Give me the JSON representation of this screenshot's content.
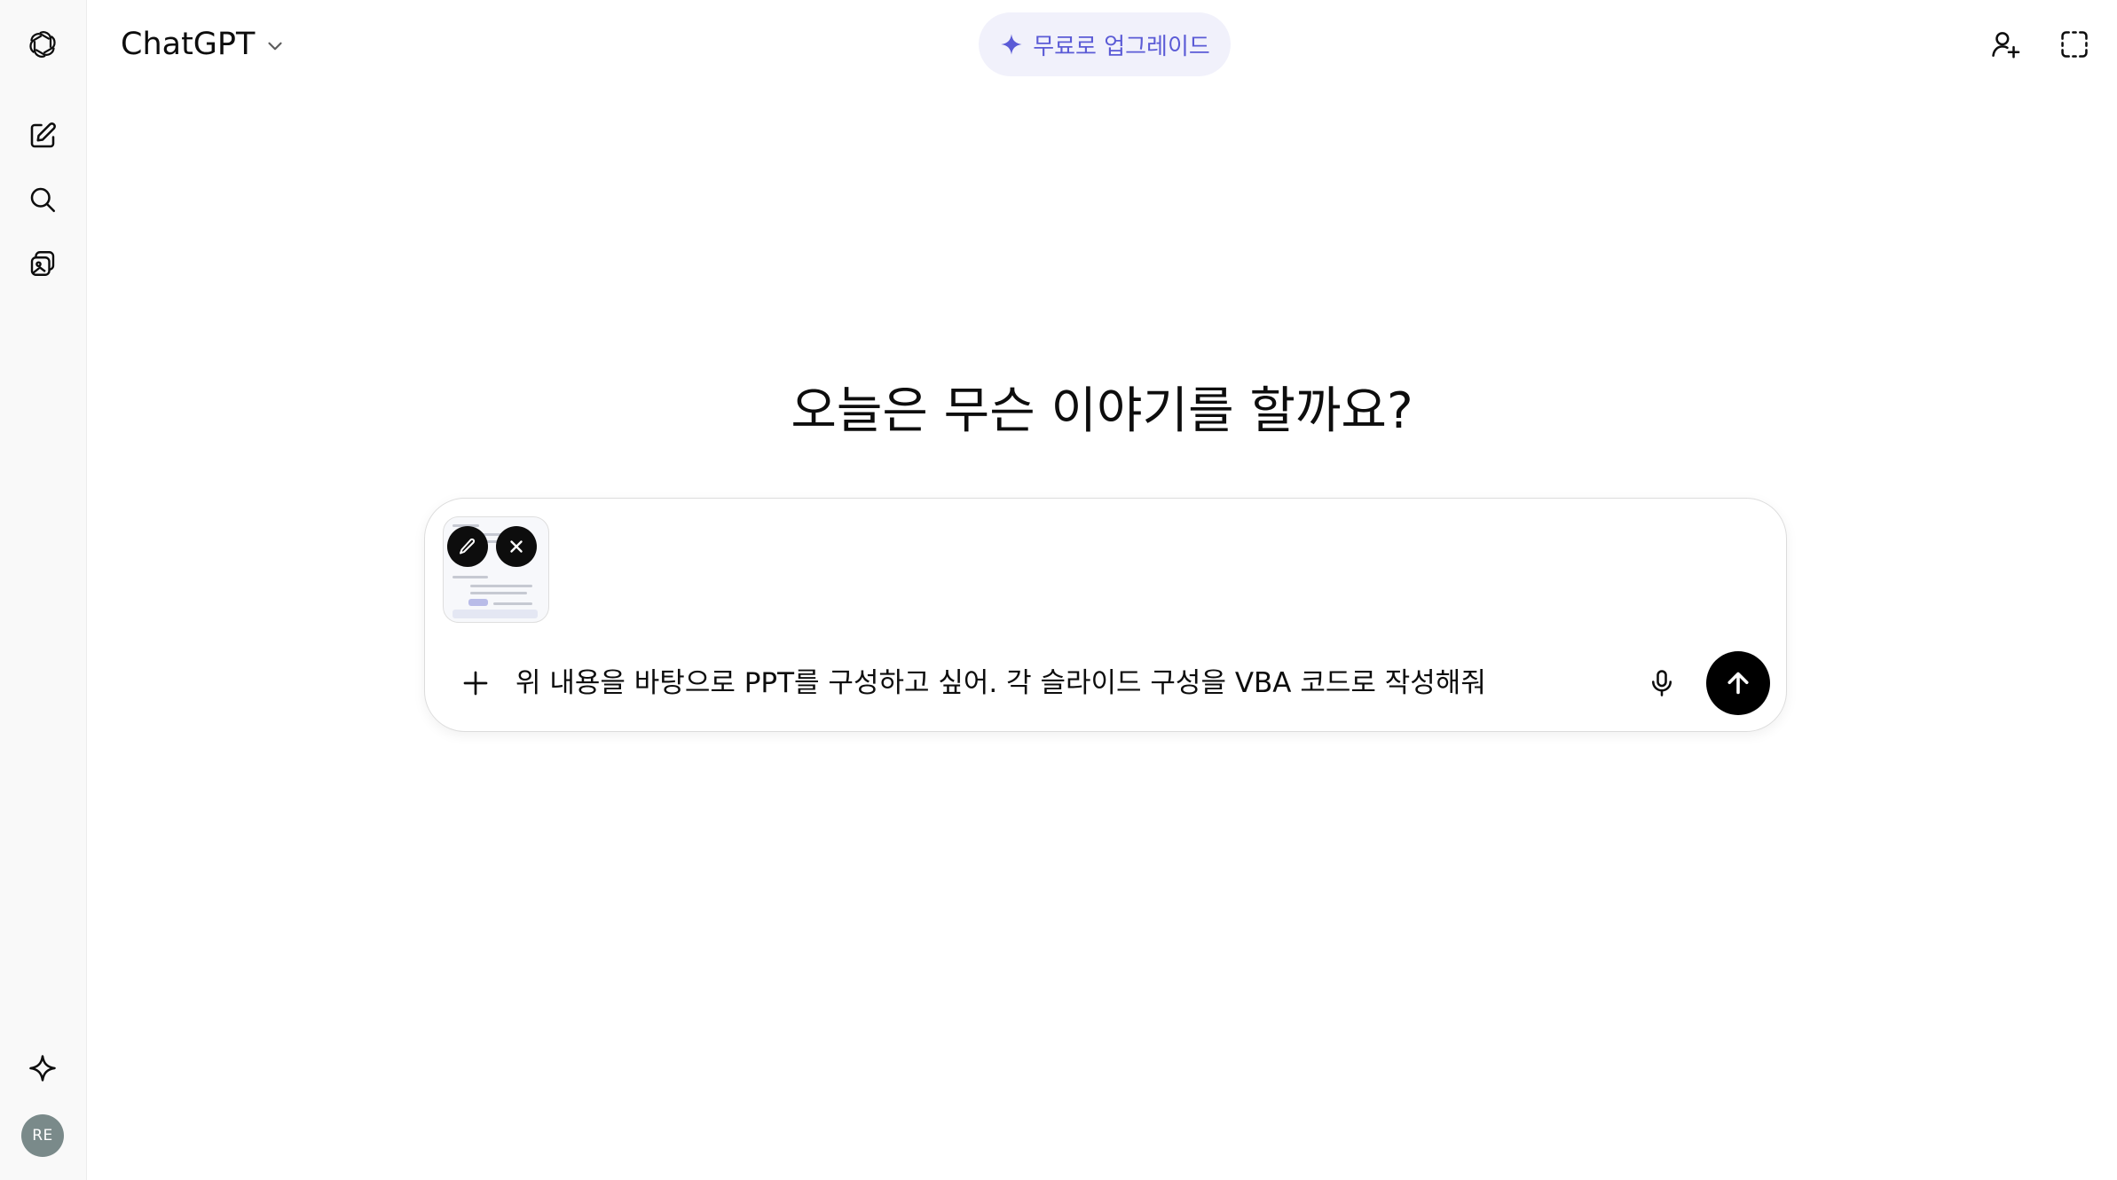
{
  "header": {
    "model_name": "ChatGPT",
    "upgrade_label": "무료로 업그레이드"
  },
  "sidebar": {
    "avatar_initials": "RE",
    "icons": [
      "openai-logo-icon",
      "new-chat-icon",
      "search-icon",
      "library-icon",
      "explore-sparkle-icon"
    ]
  },
  "main": {
    "headline": "오늘은 무슨 이야기를 할까요?"
  },
  "composer": {
    "input_value": "위 내용을 바탕으로 PPT를 구성하고 싶어. 각 슬라이드 구성을 VBA 코드로 작성해줘",
    "attachment": {
      "type": "image-thumbnail"
    }
  },
  "colors": {
    "accent": "#5b5bd6",
    "upgrade_bg": "#f1f1fb",
    "send_bg": "#000000",
    "avatar_bg": "#7a8a8a"
  }
}
